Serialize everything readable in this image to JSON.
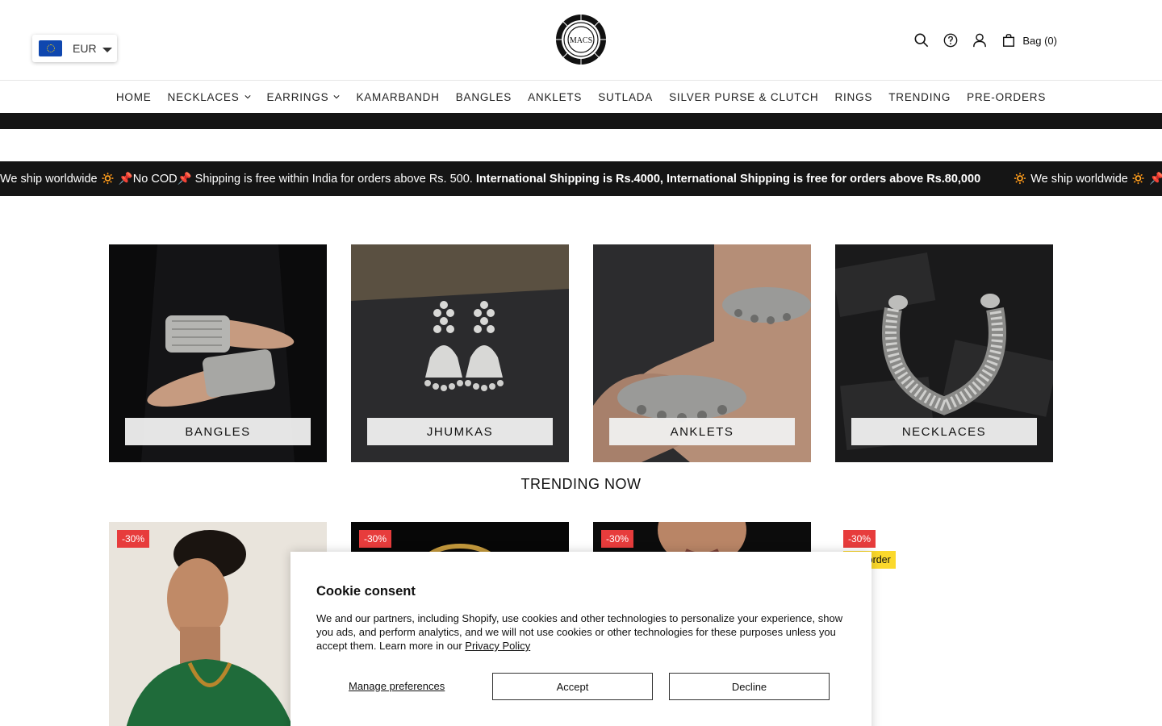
{
  "header": {
    "currency": "EUR",
    "logo_text": "MACS",
    "bag_label": "Bag (0)"
  },
  "nav": [
    {
      "label": "HOME",
      "dropdown": false
    },
    {
      "label": "NECKLACES",
      "dropdown": true
    },
    {
      "label": "EARRINGS",
      "dropdown": true
    },
    {
      "label": "KAMARBANDH",
      "dropdown": false
    },
    {
      "label": "BANGLES",
      "dropdown": false
    },
    {
      "label": "ANKLETS",
      "dropdown": false
    },
    {
      "label": "SUTLADA",
      "dropdown": false
    },
    {
      "label": "SILVER PURSE & CLUTCH",
      "dropdown": false
    },
    {
      "label": "RINGS",
      "dropdown": false
    },
    {
      "label": "TRENDING",
      "dropdown": false
    },
    {
      "label": "PRE-ORDERS",
      "dropdown": false
    }
  ],
  "announcement": {
    "part1": "We ship worldwide 🔅 📌No COD📌 Shipping is free within India for orders above Rs. 500.",
    "part2": "International Shipping is Rs.4000, International Shipping is free for orders above Rs.80,000",
    "repeat": "🔅 We ship worldwide 🔅 📌No C"
  },
  "categories": [
    {
      "label": "BANGLES"
    },
    {
      "label": "JHUMKAS"
    },
    {
      "label": "ANKLETS"
    },
    {
      "label": "NECKLACES"
    }
  ],
  "trending": {
    "title": "TRENDING NOW",
    "products": [
      {
        "discount": "-30%"
      },
      {
        "discount": "-30%"
      },
      {
        "discount": "-30%"
      },
      {
        "discount": "-30%",
        "preorder": "Pre-order"
      }
    ]
  },
  "cookie": {
    "title": "Cookie consent",
    "body": "We and our partners, including Shopify, use cookies and other technologies to personalize your experience, show you ads, and perform analytics, and we will not use cookies or other technologies for these purposes unless you accept them. Learn more in our",
    "privacy_link": "Privacy Policy",
    "manage": "Manage preferences",
    "accept": "Accept",
    "decline": "Decline"
  },
  "colors": {
    "dark_bar": "#151515",
    "discount_badge": "#e73c3c",
    "preorder_badge": "#fbd92c"
  }
}
